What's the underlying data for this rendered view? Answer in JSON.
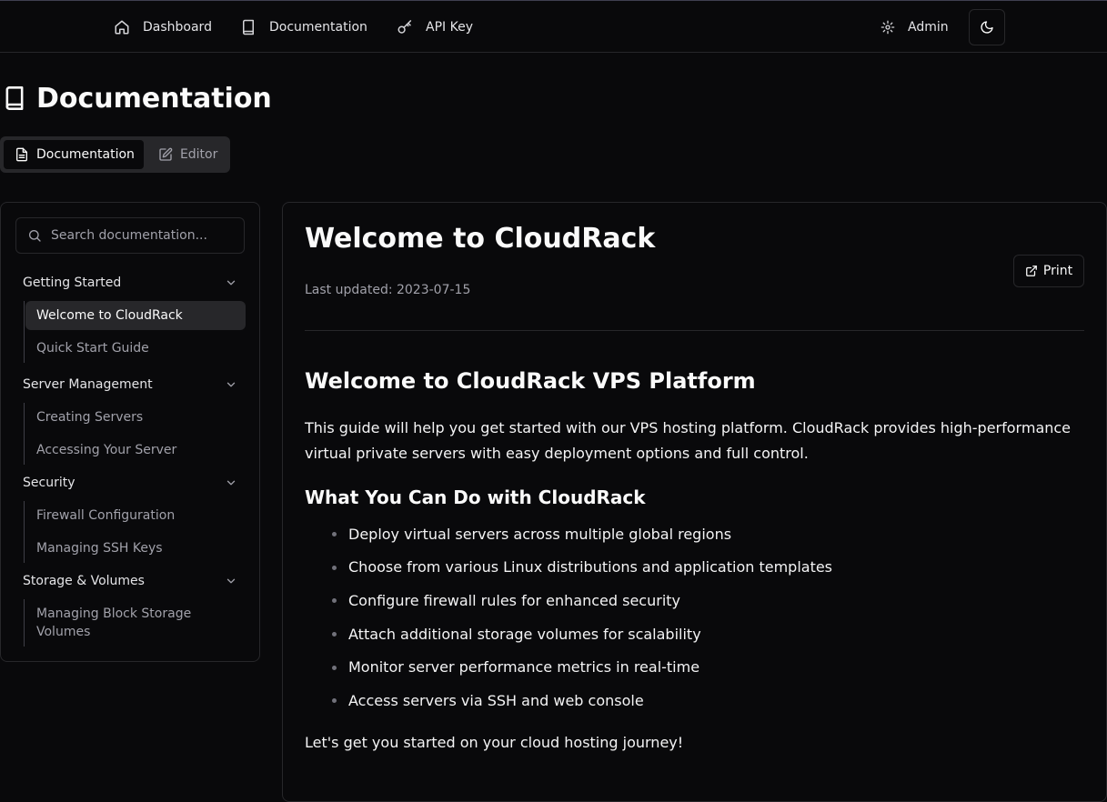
{
  "nav": {
    "dashboard": "Dashboard",
    "documentation": "Documentation",
    "api_key": "API Key",
    "admin": "Admin"
  },
  "page": {
    "title": "Documentation"
  },
  "tabs": {
    "documentation": "Documentation",
    "editor": "Editor"
  },
  "sidebar": {
    "search_placeholder": "Search documentation...",
    "groups": [
      {
        "title": "Getting Started",
        "items": [
          "Welcome to CloudRack",
          "Quick Start Guide"
        ]
      },
      {
        "title": "Server Management",
        "items": [
          "Creating Servers",
          "Accessing Your Server"
        ]
      },
      {
        "title": "Security",
        "items": [
          "Firewall Configuration",
          "Managing SSH Keys"
        ]
      },
      {
        "title": "Storage & Volumes",
        "items": [
          "Managing Block Storage Volumes"
        ]
      }
    ],
    "active_item": "Welcome to CloudRack"
  },
  "doc": {
    "title": "Welcome to CloudRack",
    "last_updated": "Last updated: 2023-07-15",
    "print_label": "Print",
    "heading": "Welcome to CloudRack VPS Platform",
    "intro": "This guide will help you get started with our VPS hosting platform. CloudRack provides high-performance virtual private servers with easy deployment options and full control.",
    "subheading": "What You Can Do with CloudRack",
    "bullets": [
      "Deploy virtual servers across multiple global regions",
      "Choose from various Linux distributions and application templates",
      "Configure firewall rules for enhanced security",
      "Attach additional storage volumes for scalability",
      "Monitor server performance metrics in real-time",
      "Access servers via SSH and web console"
    ],
    "closing": "Let's get you started on your cloud hosting journey!"
  },
  "colors": {
    "background": "#09090b",
    "border": "#27272a",
    "muted_text": "#a1a1aa",
    "active_bg": "#27272a"
  },
  "icons": {
    "dashboard": "home-icon",
    "documentation": "book-icon",
    "api_key": "key-icon",
    "admin": "gear-icon",
    "theme": "moon-icon",
    "search": "search-icon",
    "print": "external-link-icon",
    "editor": "edit-icon",
    "doc_tab": "file-text-icon",
    "chevron": "chevron-down-icon"
  }
}
